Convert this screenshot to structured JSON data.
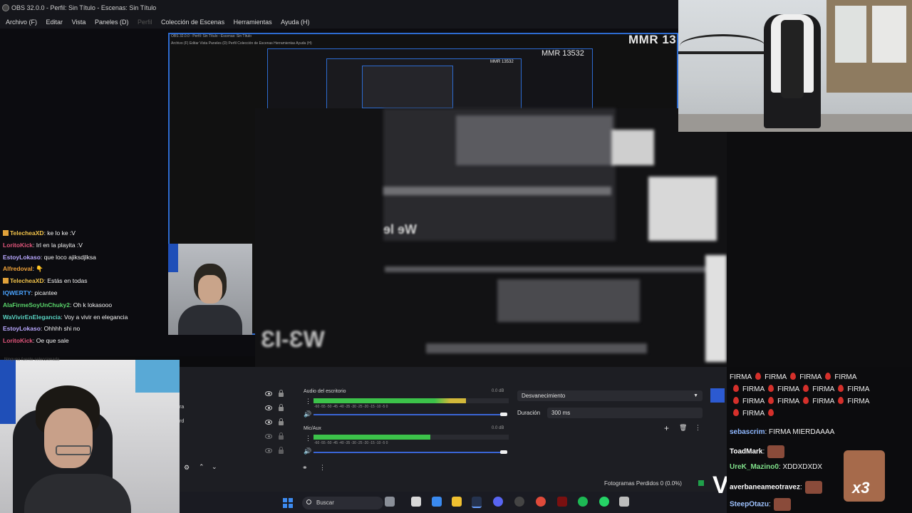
{
  "window": {
    "title": "OBS 32.0.0 - Perfil: Sin Título - Escenas: Sin Título",
    "menu": [
      "Archivo (F)",
      "Editar",
      "Vista",
      "Paneles (D)",
      "Perfil",
      "Colección de Escenas",
      "Herramientas",
      "Ayuda (H)"
    ]
  },
  "preview": {
    "nested_title": "OBS 32.0.0 - Perfil: Sin Título - Escenas: Sin Título",
    "nested_menu": "Archivo (F)   Editar   Vista   Paneles (D)   Perfil   Colección de Escenas   Herramientas   Ayuda (H)",
    "mmr_big": "MMR 13",
    "mmr_mid": "MMR 13532",
    "mmr_small": "MMR 13532",
    "blur_text_1": "ɘl ɘW",
    "blur_text_2": "ƐI-ƐW"
  },
  "chat_left": [
    {
      "name": "TelecheaXD",
      "color": "#f0c24a",
      "badge": true,
      "text": ": ke lo ke :V"
    },
    {
      "name": "LoritoKick",
      "color": "#e0557a",
      "badge": false,
      "text": ": Irl en la playita :V"
    },
    {
      "name": "EstoyLokaso",
      "color": "#b9a8ff",
      "badge": false,
      "text": ": que loco ajiksdjlksa"
    },
    {
      "name": "Alfredoval",
      "color": "#f0a23a",
      "badge": false,
      "text": ": 👇"
    },
    {
      "name": "TelecheaXD",
      "color": "#f0c24a",
      "badge": true,
      "text": ": Estás en todas"
    },
    {
      "name": "IQWERTY",
      "color": "#4aa3ff",
      "badge": false,
      "text": ": picantee"
    },
    {
      "name": "AlaFirmeSoyUnChuky2",
      "color": "#59d36a",
      "badge": false,
      "text": ": Oh k lokasooo"
    },
    {
      "name": "WaVivirEnElegancia",
      "color": "#59d3c3",
      "badge": false,
      "text": ": Voy a vivir en elegancia"
    },
    {
      "name": "EstoyLokaso",
      "color": "#b9a8ff",
      "badge": false,
      "text": ": Ohhhh shi no"
    },
    {
      "name": "LoritoKick",
      "color": "#e0557a",
      "badge": false,
      "text": ": Oe que sale"
    }
  ],
  "chat_right": {
    "firma_word": "FIRMA",
    "firma_rows": [
      [
        "FIRMA",
        "FIRMA",
        "FIRMA",
        "FIRMA"
      ],
      [
        "FIRMA",
        "FIRMA",
        "FIRMA",
        "FIRMA"
      ],
      [
        "FIRMA",
        "FIRMA",
        "FIRMA",
        "FIRMA"
      ],
      [
        "FIRMA"
      ]
    ],
    "messages": [
      {
        "name": "sebascrim",
        "color": "#8fb8ff",
        "text": ": FIRMA MIERDAAAA",
        "emote": false
      },
      {
        "name": "ToadMark",
        "color": "#ffffff",
        "text": ":",
        "emote": true
      },
      {
        "name": "UreK_Mazino0",
        "color": "#7fe08a",
        "text": ": XDDXDXDX",
        "emote": false
      },
      {
        "name": "averbaneameotravez",
        "color": "#ffffff",
        "text": ":",
        "emote": true
      },
      {
        "name": "SteepOtazu",
        "color": "#9fc3ff",
        "text": ":",
        "emote": true
      }
    ],
    "big_emote_mult": "x3"
  },
  "sources": {
    "labels": [
      "ra",
      "rd"
    ],
    "selected_text": "Ninguna fuente seleccionada"
  },
  "mixer": {
    "channels": [
      {
        "name": "Audio del escritorio",
        "db": "0.0 dB",
        "level": 0.78
      },
      {
        "name": "Mic/Aux",
        "db": "0.0 dB",
        "level": 0.6
      }
    ],
    "ticks": "-60  -55  -50  -45  -40  -35  -30  -25  -20  -15  -10  -5  0"
  },
  "transitions": {
    "selected": "Desvanecimiento",
    "duration_label": "Duración",
    "duration_value": "300 ms"
  },
  "status_bar": {
    "dropped_frames": "Fotogramas Perdidos 0 (0.0%)"
  },
  "taskbar": {
    "search_placeholder": "Buscar"
  },
  "colors": {
    "accent": "#2d6bd0",
    "meter_green": "#3cc24a",
    "meter_yellow": "#d2b83a",
    "meter_red": "#c8322c"
  }
}
